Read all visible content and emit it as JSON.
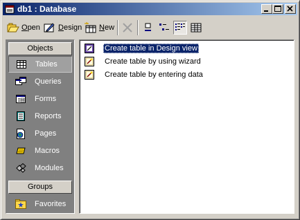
{
  "window": {
    "title": "db1 : Database"
  },
  "toolbar": {
    "open_label": "Open",
    "open_accel": "O",
    "design_label": "Design",
    "design_accel": "D",
    "new_label": "New",
    "new_accel": "N"
  },
  "sidebar": {
    "objects_header": "Objects",
    "groups_header": "Groups",
    "items": [
      {
        "label": "Tables",
        "icon": "table-icon",
        "selected": true
      },
      {
        "label": "Queries",
        "icon": "query-icon"
      },
      {
        "label": "Forms",
        "icon": "form-icon"
      },
      {
        "label": "Reports",
        "icon": "report-icon"
      },
      {
        "label": "Pages",
        "icon": "page-icon"
      },
      {
        "label": "Macros",
        "icon": "macro-icon"
      },
      {
        "label": "Modules",
        "icon": "module-icon"
      }
    ],
    "favorites": "Favorites"
  },
  "list": {
    "items": [
      {
        "label": "Create table in Design view",
        "selected": true
      },
      {
        "label": "Create table by using wizard"
      },
      {
        "label": "Create table by entering data"
      }
    ]
  },
  "colors": {
    "title_start": "#0a246a",
    "title_end": "#a6caf0",
    "selection": "#0a246a",
    "face": "#d4d0c8"
  }
}
